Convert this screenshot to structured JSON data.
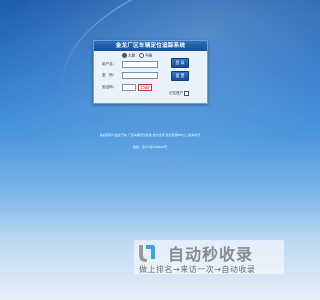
{
  "window": {
    "title": "金龙厂区车辆定位追踪系统"
  },
  "login": {
    "radio_options": [
      "大屏",
      "列表"
    ],
    "selected_radio": "大屏",
    "username_label": "用户名：",
    "password_label": "密　码：",
    "captcha_label": "验证码：",
    "username_value": "",
    "password_value": "",
    "captcha_value": "",
    "captcha_image_text": "1584",
    "login_button": "登 录",
    "reset_button": "重 置",
    "remember_label": "记住账户"
  },
  "footer": {
    "line1": "版权所有©金龙汽车 厂区车辆定位系统 技术支持 建议使用IE8以上版本浏览",
    "line2": "备案：京ICP证000000号"
  },
  "watermark": {
    "title": "自动秒收录",
    "subtitle": "做上排名→来访一次→自动收录"
  },
  "colors": {
    "accent": "#174f97",
    "bg_top": "#1f5fae",
    "captcha": "#dd1111"
  }
}
